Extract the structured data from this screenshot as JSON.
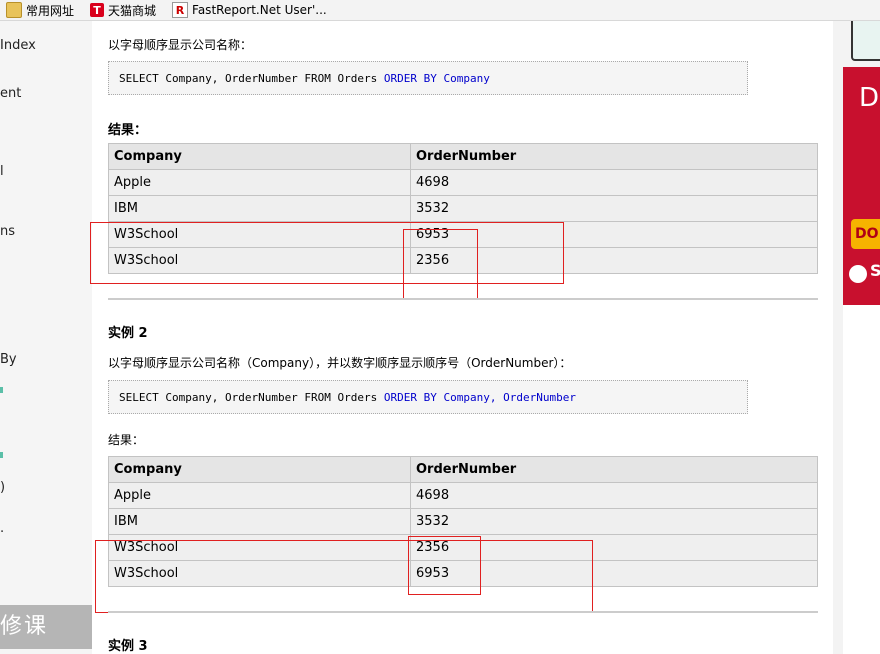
{
  "bookmarks": [
    {
      "label": "常用网址",
      "icon": "folder-icon"
    },
    {
      "label": "天猫商城",
      "icon": "tmall-icon",
      "glyph": "T"
    },
    {
      "label": "FastReport.Net User'...",
      "icon": "fastreport-icon",
      "glyph": "R"
    }
  ],
  "sidebar": {
    "items": [
      "Index",
      "ent",
      "l",
      "ns",
      "By",
      ")",
      "."
    ],
    "promo": "修课"
  },
  "example1": {
    "description": "以字母顺序显示公司名称：",
    "sql_plain": "SELECT Company, OrderNumber FROM Orders",
    "sql_kw": "ORDER BY Company",
    "result_label": "结果：",
    "table": {
      "headers": [
        "Company",
        "OrderNumber"
      ],
      "rows": [
        [
          "Apple",
          "4698"
        ],
        [
          "IBM",
          "3532"
        ],
        [
          "W3School",
          "6953"
        ],
        [
          "W3School",
          "2356"
        ]
      ]
    }
  },
  "example2": {
    "title": "实例 2",
    "description": "以字母顺序显示公司名称（Company），并以数字顺序显示顺序号（OrderNumber）：",
    "sql_plain": "SELECT Company, OrderNumber FROM Orders",
    "sql_kw": "ORDER BY Company, OrderNumber",
    "result_label": "结果：",
    "table": {
      "headers": [
        "Company",
        "OrderNumber"
      ],
      "rows": [
        [
          "Apple",
          "4698"
        ],
        [
          "IBM",
          "3532"
        ],
        [
          "W3School",
          "2356"
        ],
        [
          "W3School",
          "6953"
        ]
      ]
    }
  },
  "example3": {
    "title": "实例 3"
  },
  "ad": {
    "text": "D",
    "button": "DO",
    "brand": "S"
  },
  "colors": {
    "keyword": "#0000cc",
    "annotation": "#e02020",
    "ad": "#c8102e"
  }
}
